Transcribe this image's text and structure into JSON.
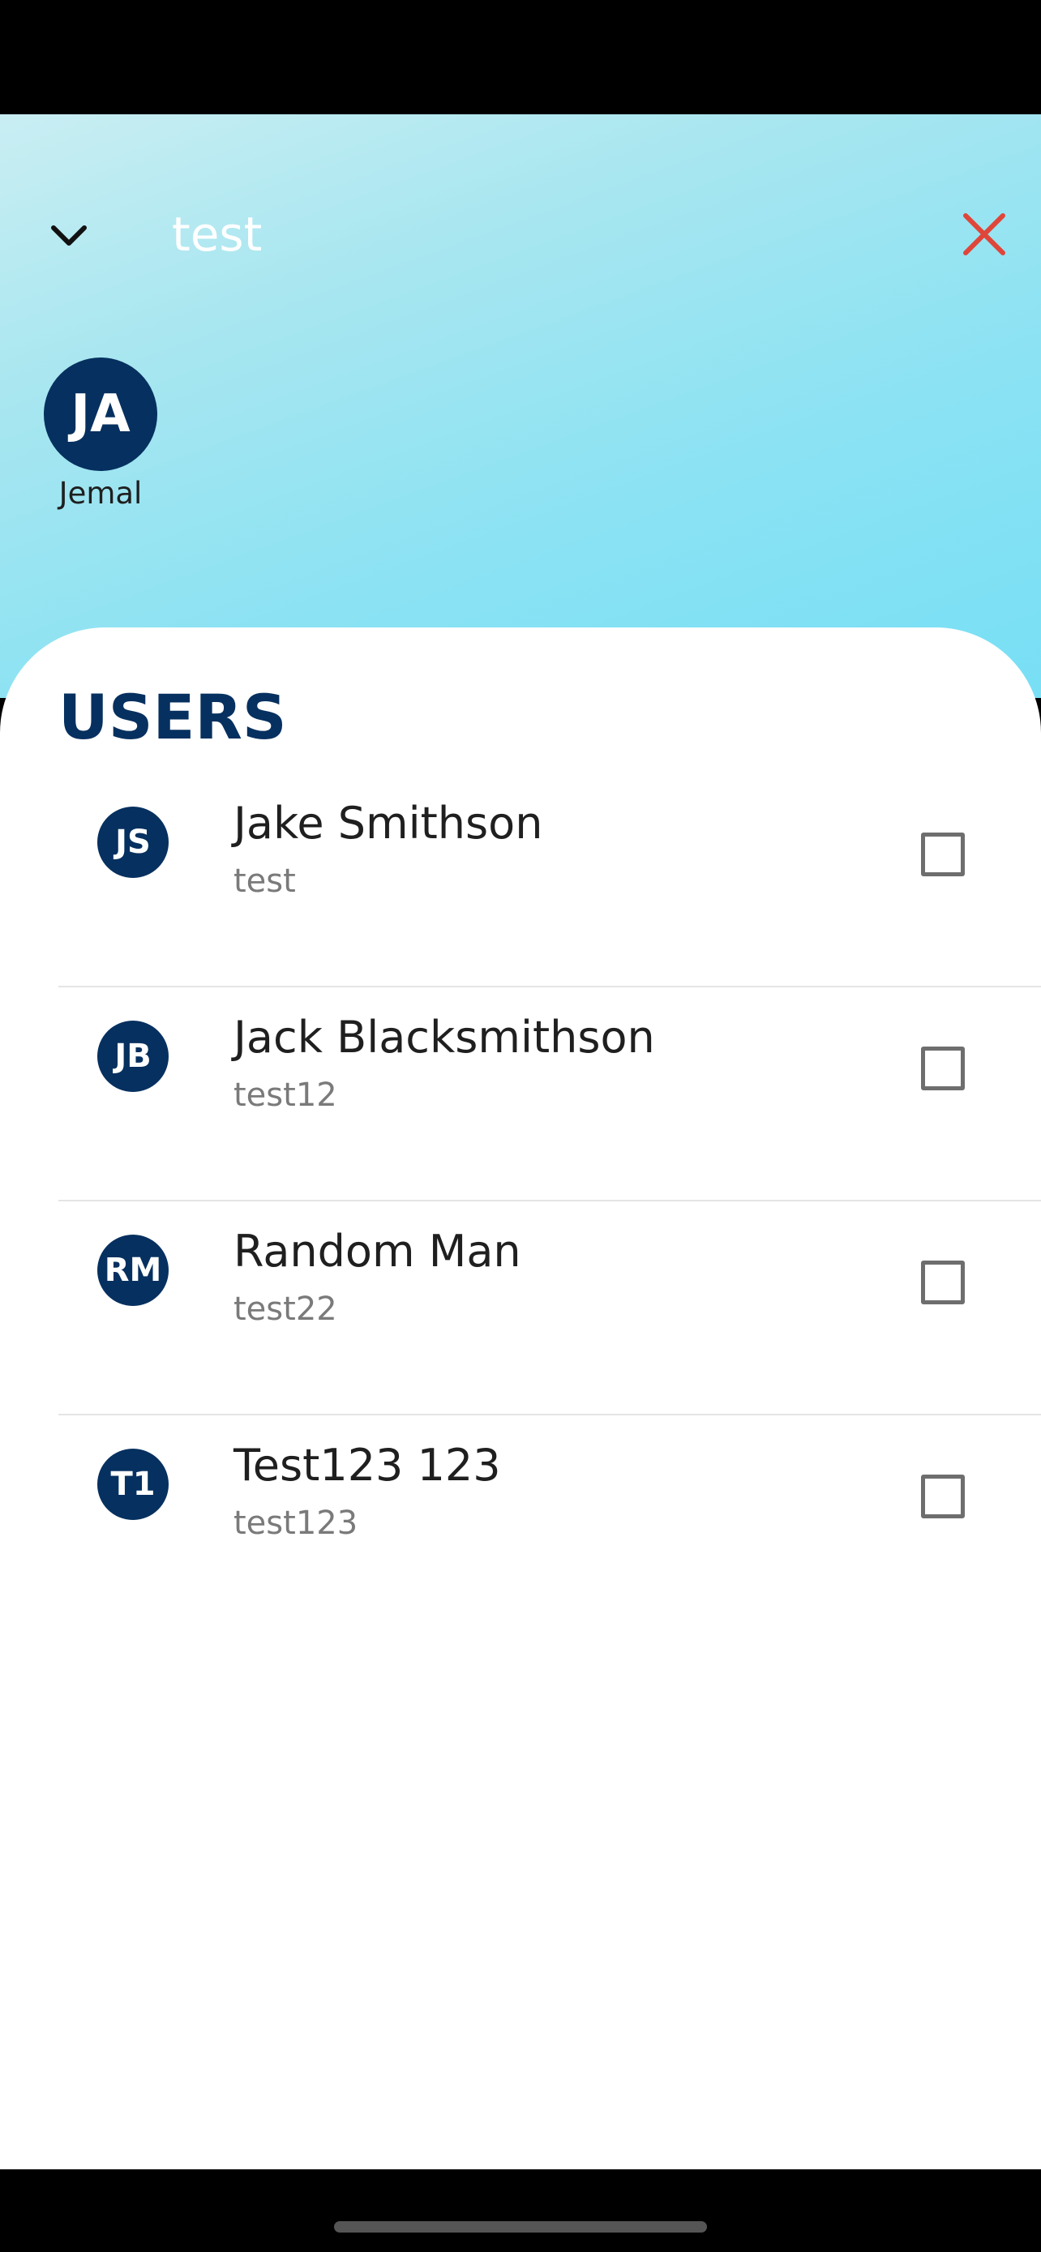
{
  "search": {
    "value": "test",
    "collapse_icon": "chevron-down-icon",
    "clear_icon": "close-icon",
    "clear_icon_color": "#e0453a"
  },
  "selected": [
    {
      "initials": "JA",
      "name": "Jemal"
    }
  ],
  "users_section": {
    "title": "USERS",
    "items": [
      {
        "initials": "JS",
        "name": "Jake Smithson",
        "username": "test",
        "checked": false
      },
      {
        "initials": "JB",
        "name": "Jack Blacksmithson",
        "username": "test12",
        "checked": false
      },
      {
        "initials": "RM",
        "name": "Random Man",
        "username": "test22",
        "checked": false
      },
      {
        "initials": "T1",
        "name": "Test123 123",
        "username": "test123",
        "checked": false
      }
    ]
  },
  "colors": {
    "avatar_bg": "#06305f",
    "title": "#06305f",
    "header_gradient_start": "#c9eef3",
    "header_gradient_end": "#78dff5"
  }
}
